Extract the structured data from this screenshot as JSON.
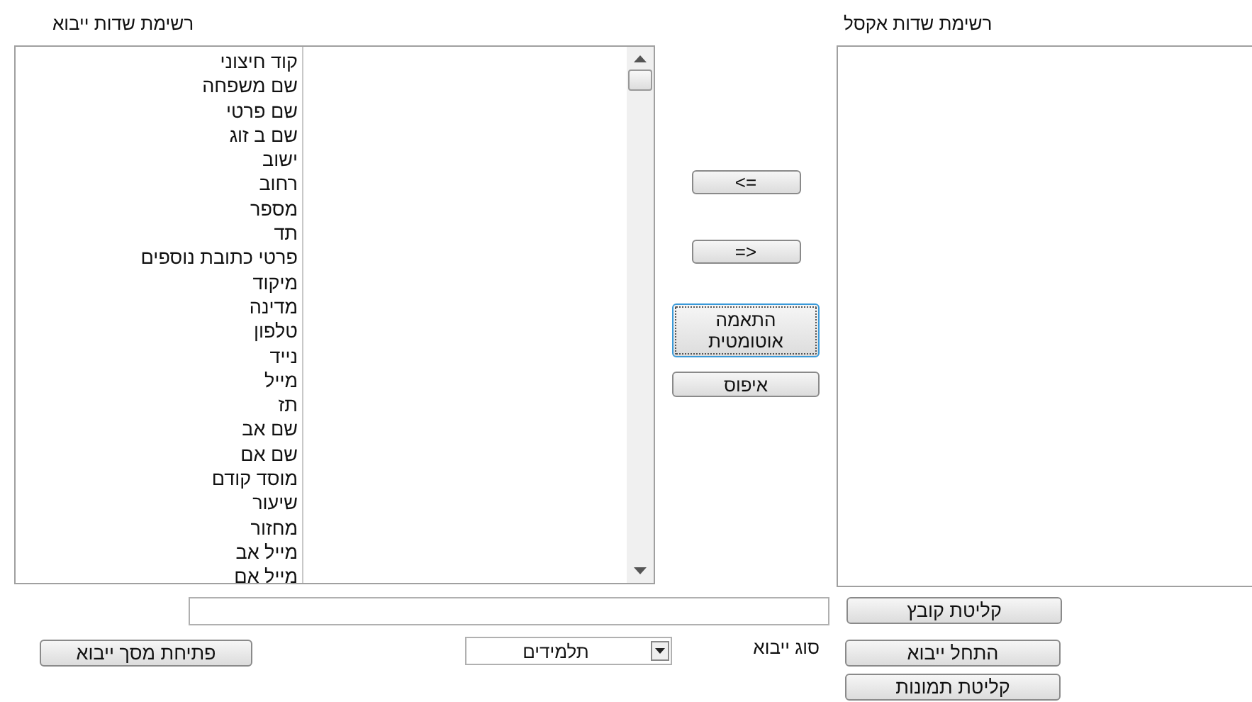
{
  "import_fields": {
    "title": "רשימת שדות  ייבוא",
    "items": [
      {
        "label": "קוד חיצוני"
      },
      {
        "label": "שם משפחה"
      },
      {
        "label": "שם פרטי"
      },
      {
        "label": "שם ב זוג"
      },
      {
        "label": "ישוב"
      },
      {
        "label": "רחוב"
      },
      {
        "label": "מספר"
      },
      {
        "label": "תד"
      },
      {
        "label": "פרטי כתובת נוספים"
      },
      {
        "label": "מיקוד"
      },
      {
        "label": "מדינה"
      },
      {
        "label": "טלפון"
      },
      {
        "label": "נייד"
      },
      {
        "label": "מייל"
      },
      {
        "label": "תז"
      },
      {
        "label": "שם אב"
      },
      {
        "label": "שם אם"
      },
      {
        "label": "מוסד קודם"
      },
      {
        "label": "שיעור"
      },
      {
        "label": "מחזור"
      },
      {
        "label": "מייל אב"
      },
      {
        "label": "מייל אם"
      }
    ]
  },
  "excel_fields": {
    "title": "רשימת שדות  אקסל"
  },
  "middle_buttons": [
    {
      "label": "<=",
      "focused": false
    },
    {
      "label": "=>",
      "focused": false
    },
    {
      "label": "התאמה אוטומטית",
      "focused": true
    },
    {
      "label": "איפוס",
      "focused": false
    }
  ],
  "load_file_button": "קליטת קובץ",
  "open_import_screen_button": "פתיחת מסך ייבוא",
  "import_type": {
    "label": "סוג ייבוא",
    "value": "תלמידים"
  },
  "start_import_button": "התחל ייבוא",
  "load_images_button": "קליטת תמונות"
}
